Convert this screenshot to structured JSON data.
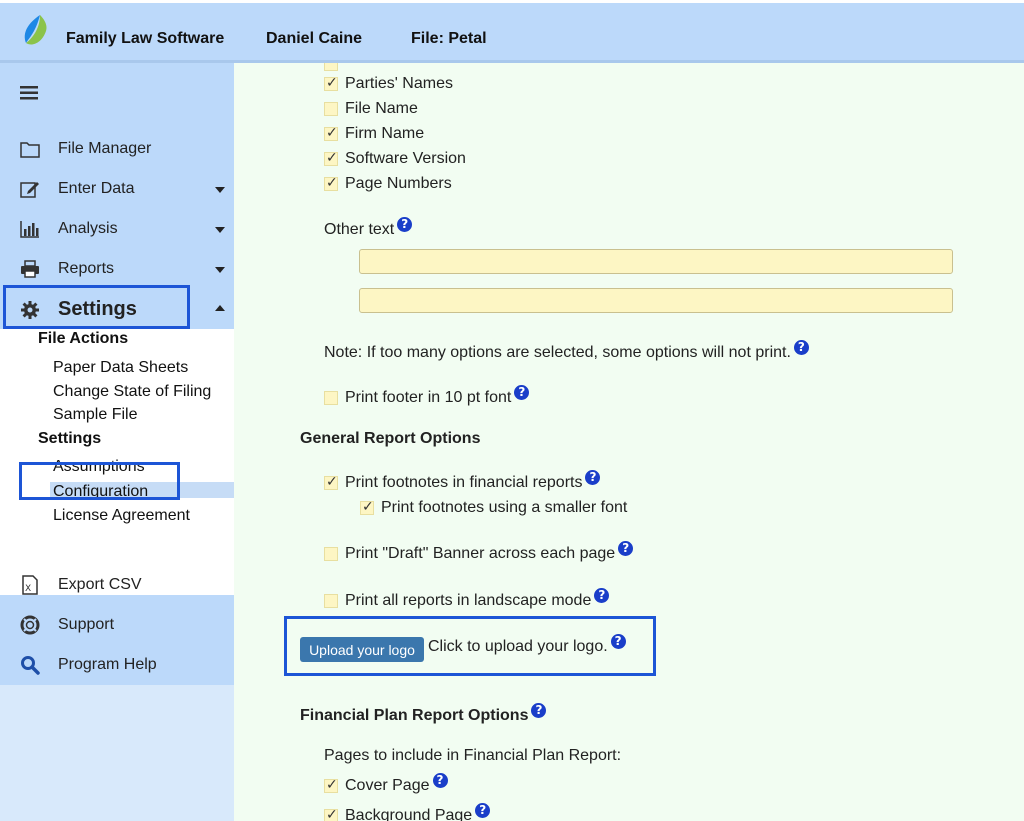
{
  "header": {
    "app_name": "Family Law Software",
    "user_name": "Daniel Caine",
    "file_label": "File: Petal"
  },
  "sidebar": {
    "menu_icon": "hamburger-icon",
    "nav": [
      {
        "label": "File Manager",
        "icon": "folder-icon"
      },
      {
        "label": "Enter Data",
        "icon": "edit-icon"
      },
      {
        "label": "Analysis",
        "icon": "bar-chart-icon"
      },
      {
        "label": "Reports",
        "icon": "printer-icon"
      },
      {
        "label": "Settings",
        "icon": "gear-icon"
      }
    ],
    "settings_sub": {
      "file_actions_heading": "File Actions",
      "file_actions": [
        "Paper Data Sheets",
        "Change State of Filing",
        "Sample File"
      ],
      "settings_heading": "Settings",
      "settings_items": [
        "Assumptions",
        "Configuration",
        "License Agreement"
      ]
    },
    "bottom_nav": [
      {
        "label": "Export CSV",
        "icon": "csv-file-icon"
      },
      {
        "label": "Support",
        "icon": "lifebuoy-icon"
      },
      {
        "label": "Program Help",
        "icon": "search-icon"
      }
    ]
  },
  "main": {
    "footer_options": [
      {
        "label": "Parties' Names",
        "checked": true
      },
      {
        "label": "File Name",
        "checked": false
      },
      {
        "label": "Firm Name",
        "checked": true
      },
      {
        "label": "Software Version",
        "checked": true
      },
      {
        "label": "Page Numbers",
        "checked": true
      }
    ],
    "other_text_label": "Other text",
    "other_text_values": [
      "",
      ""
    ],
    "note": "Note: If too many options are selected, some options will not print.",
    "print_footer_10pt": {
      "label": "Print footer in 10 pt font",
      "checked": false
    },
    "general_heading": "General Report Options",
    "print_footnotes": {
      "label": "Print footnotes in financial reports",
      "checked": true
    },
    "footnotes_smaller": {
      "label": "Print footnotes using a smaller font",
      "checked": true
    },
    "draft_banner": {
      "label": "Print \"Draft\" Banner across each page",
      "checked": false
    },
    "landscape": {
      "label": "Print all reports in landscape mode",
      "checked": false
    },
    "upload_button": "Upload your logo",
    "upload_text": "Click to upload your logo.",
    "financial_heading": "Financial Plan Report Options",
    "pages_label": "Pages to include in Financial Plan Report:",
    "fp_pages": [
      {
        "label": "Cover Page",
        "checked": true
      },
      {
        "label": "Background Page",
        "checked": true
      }
    ],
    "help_glyph": "?"
  },
  "colors": {
    "header_bg": "#bcd9fa",
    "main_bg": "#f2fdf2",
    "checkbox_bg": "#fdf6c4",
    "highlight_border": "#1d55d6",
    "button_bg": "#3b77ad",
    "help_icon": "#1a3ec9"
  }
}
